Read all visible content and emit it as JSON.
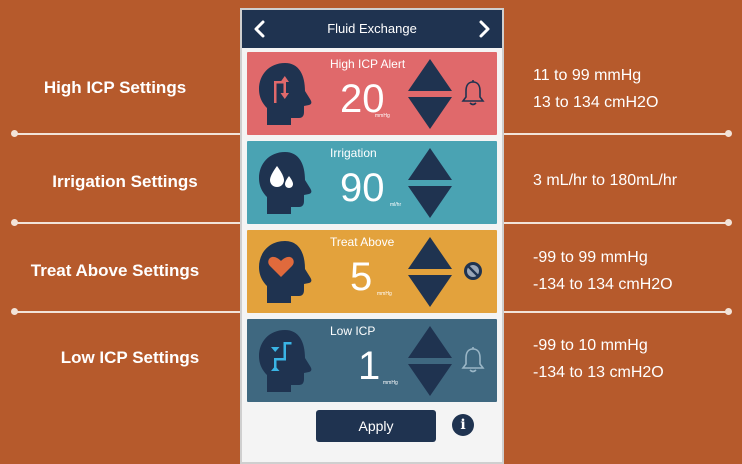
{
  "header": {
    "title": "Fluid Exchange"
  },
  "cards": [
    {
      "title": "High ICP Alert",
      "value": "20",
      "unit": "mmHg",
      "color": "#e0696b",
      "aux_icon": "bell-icon",
      "head_icon": "pressure-up-icon"
    },
    {
      "title": "Irrigation",
      "value": "90",
      "unit": "ml/hr",
      "color": "#4aa3b3",
      "aux_icon": "",
      "head_icon": "droplets-icon"
    },
    {
      "title": "Treat Above",
      "value": "5",
      "unit": "mmHg",
      "color": "#e3a23c",
      "aux_icon": "no-symbol-icon",
      "head_icon": "heart-icon"
    },
    {
      "title": "Low ICP",
      "value": "1",
      "unit": "mmHg",
      "color": "#3f6880",
      "aux_icon": "bell-icon",
      "head_icon": "pressure-down-icon"
    }
  ],
  "footer": {
    "apply_label": "Apply",
    "info_glyph": "i"
  },
  "settings": [
    {
      "label": "High ICP Settings",
      "range_line1": "11 to 99 mmHg",
      "range_line2": "13 to 134 cmH2O"
    },
    {
      "label": "Irrigation Settings",
      "range_line1": "3 mL/hr to 180mL/hr",
      "range_line2": ""
    },
    {
      "label": "Treat Above Settings",
      "range_line1": "-99 to 99 mmHg",
      "range_line2": "-134 to 134 cmH2O"
    },
    {
      "label": "Low ICP Settings",
      "range_line1": "-99 to 10 mmHg",
      "range_line2": "-134 to 13 cmH2O"
    }
  ],
  "colors": {
    "background": "#b65a2c",
    "navy": "#1f3350",
    "divider": "#f2e3d8"
  }
}
